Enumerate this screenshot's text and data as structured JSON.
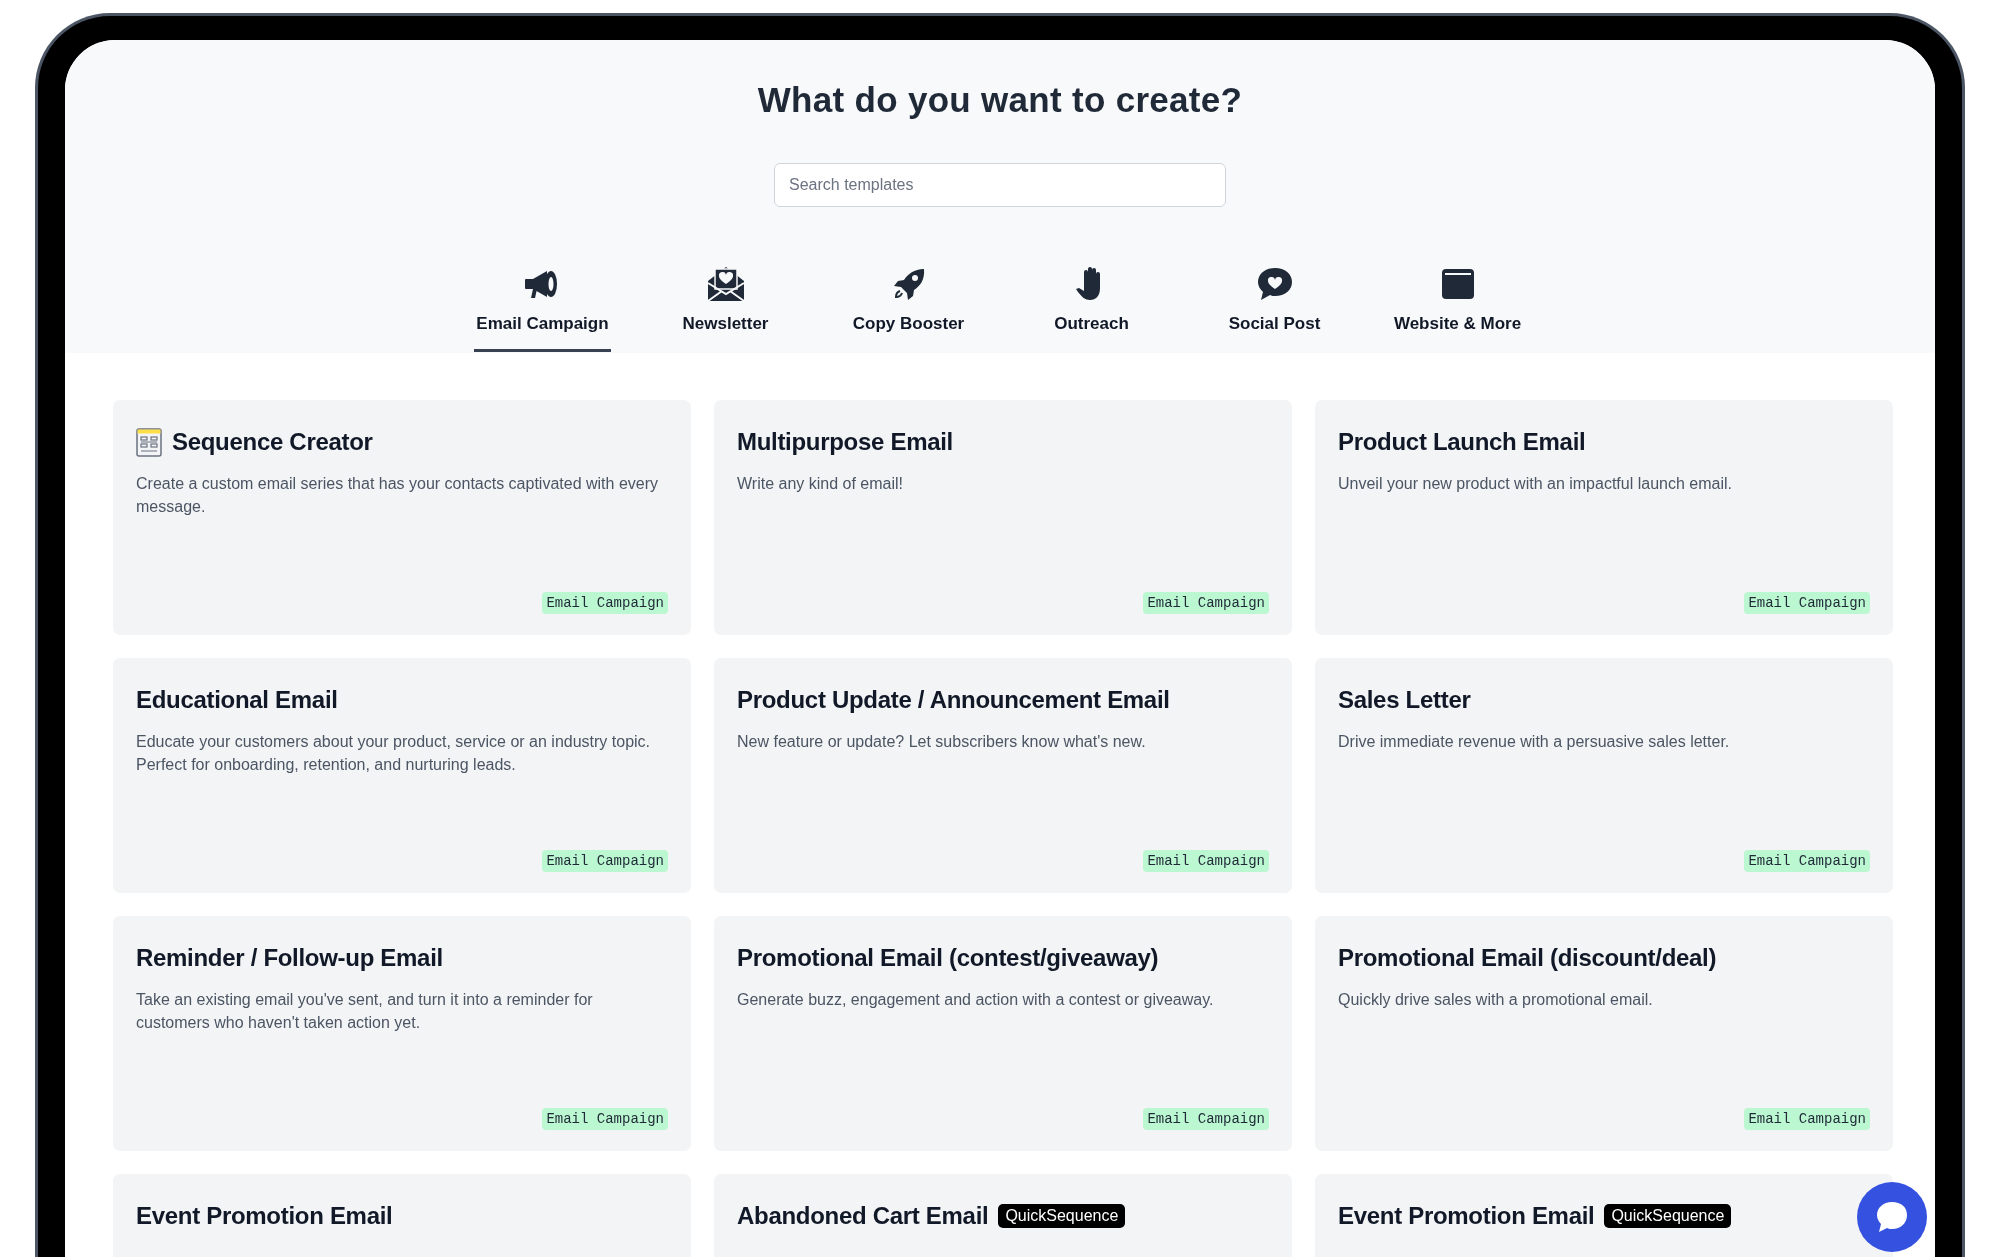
{
  "title": "What do you want to create?",
  "search": {
    "placeholder": "Search templates"
  },
  "tabs": [
    {
      "label": "Email Campaign",
      "selected": true
    },
    {
      "label": "Newsletter",
      "selected": false
    },
    {
      "label": "Copy Booster",
      "selected": false
    },
    {
      "label": "Outreach",
      "selected": false
    },
    {
      "label": "Social Post",
      "selected": false
    },
    {
      "label": "Website & More",
      "selected": false
    }
  ],
  "cards": [
    {
      "title": "Sequence Creator",
      "icon": true,
      "description": "Create a custom email series that has your contacts captivated with every message.",
      "tag": "Email Campaign"
    },
    {
      "title": "Multipurpose Email",
      "description": "Write any kind of email!",
      "tag": "Email Campaign"
    },
    {
      "title": "Product Launch Email",
      "description": "Unveil your new product with an impactful launch email.",
      "tag": "Email Campaign"
    },
    {
      "title": "Educational Email",
      "description": "Educate your customers about your product, service or an industry topic. Perfect for onboarding, retention, and nurturing leads.",
      "tag": "Email Campaign"
    },
    {
      "title": "Product Update / Announcement Email",
      "description": "New feature or update? Let subscribers know what's new.",
      "tag": "Email Campaign"
    },
    {
      "title": "Sales Letter",
      "description": "Drive immediate revenue with a persuasive sales letter.",
      "tag": "Email Campaign"
    },
    {
      "title": "Reminder / Follow-up Email",
      "description": "Take an existing email you've sent, and turn it into a reminder for customers who haven't taken action yet.",
      "tag": "Email Campaign"
    },
    {
      "title": "Promotional Email (contest/giveaway)",
      "description": "Generate buzz, engagement and action with a contest or giveaway.",
      "tag": "Email Campaign"
    },
    {
      "title": "Promotional Email (discount/deal)",
      "description": "Quickly drive sales with a promotional email.",
      "tag": "Email Campaign"
    },
    {
      "title": "Event Promotion Email"
    },
    {
      "title": "Abandoned Cart Email",
      "badge": "QuickSequence"
    },
    {
      "title": "Event Promotion Email",
      "badge": "QuickSequence"
    }
  ]
}
